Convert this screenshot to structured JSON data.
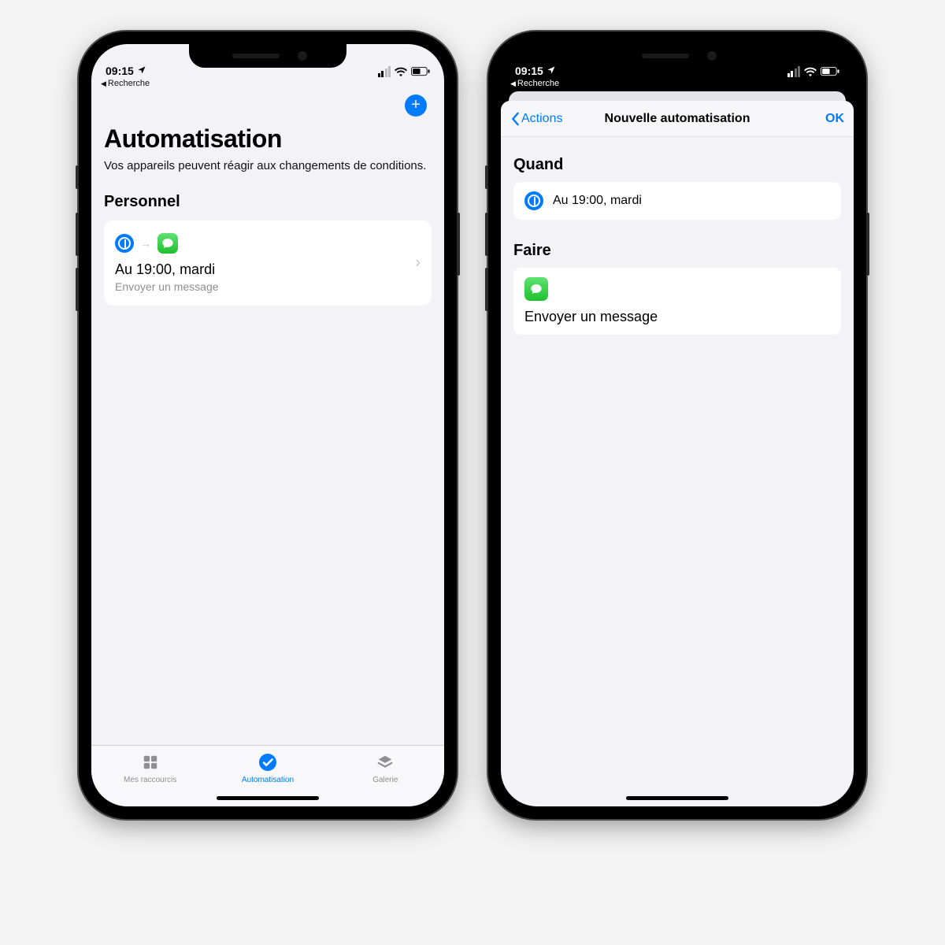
{
  "status": {
    "time": "09:15",
    "breadcrumb": "Recherche"
  },
  "left": {
    "title": "Automatisation",
    "subtitle": "Vos appareils peuvent réagir aux changements de conditions.",
    "section": "Personnel",
    "automation": {
      "title": "Au 19:00, mardi",
      "subtitle": "Envoyer un message"
    },
    "tabs": {
      "shortcuts": "Mes raccourcis",
      "automation": "Automatisation",
      "gallery": "Galerie"
    }
  },
  "right": {
    "nav_back": "Actions",
    "nav_title": "Nouvelle automatisation",
    "nav_ok": "OK",
    "when_header": "Quand",
    "when_value": "Au 19:00, mardi",
    "do_header": "Faire",
    "do_value": "Envoyer un message"
  }
}
